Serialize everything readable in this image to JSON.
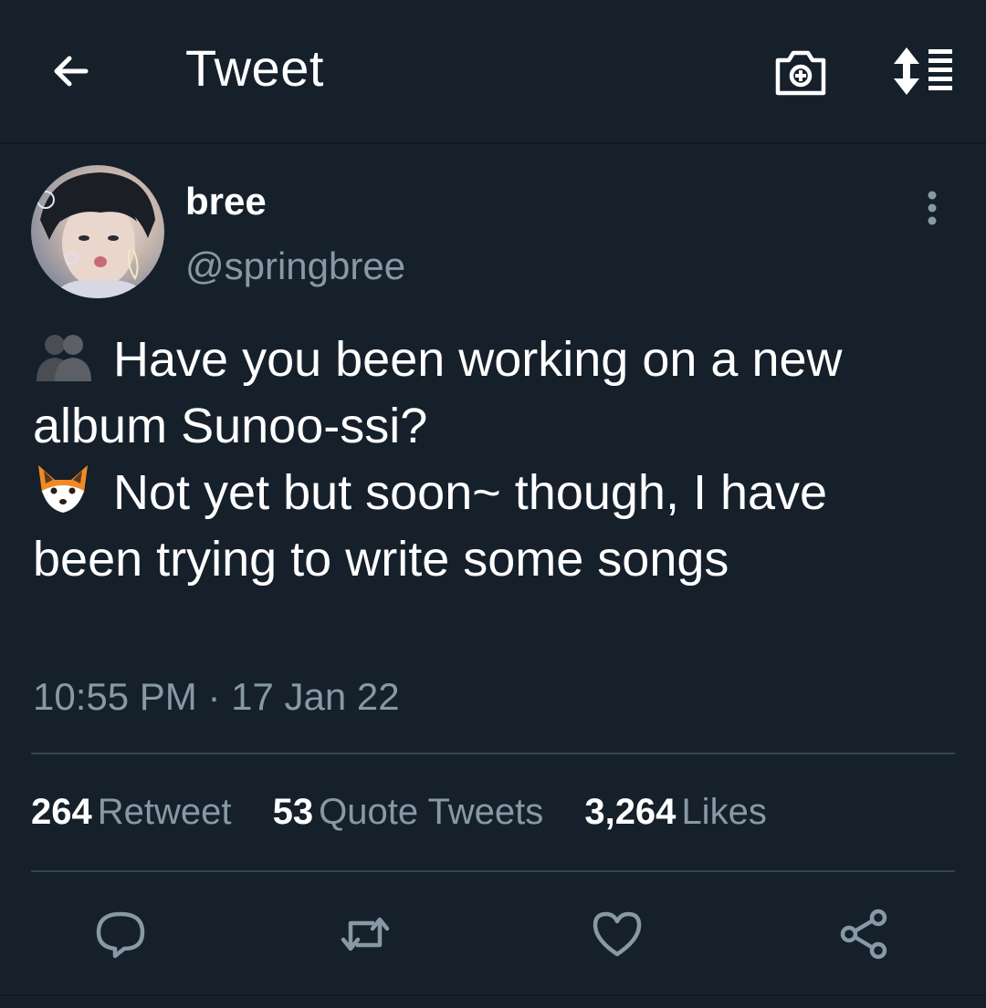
{
  "header": {
    "title": "Tweet",
    "back_icon": "arrow-left-icon",
    "camera_icon": "camera-plus-icon",
    "sort_icon": "sort-list-icon"
  },
  "author": {
    "display_name": "bree",
    "handle": "@springbree",
    "more_icon": "vertical-dots-icon"
  },
  "tweet": {
    "lines": [
      {
        "emoji": "busts-in-silhouette-emoji",
        "text": "Have you been working on a new"
      },
      {
        "emoji": "",
        "text": "album Sunoo-ssi?"
      },
      {
        "emoji": "fox-face-emoji",
        "text": "Not yet but soon~ though, I have"
      },
      {
        "emoji": "",
        "text": "been trying to write some songs"
      }
    ]
  },
  "timestamp": "10:55 PM · 17 Jan 22",
  "stats": [
    {
      "count": "264",
      "label": "Retweet"
    },
    {
      "count": "53",
      "label": "Quote Tweets"
    },
    {
      "count": "3,264",
      "label": "Likes"
    }
  ],
  "actions": [
    "reply-icon",
    "retweet-icon",
    "like-icon",
    "share-icon"
  ],
  "colors": {
    "background": "#15202b",
    "primary_text": "#ffffff",
    "secondary_text": "#8899a6",
    "divider": "#38444d"
  }
}
